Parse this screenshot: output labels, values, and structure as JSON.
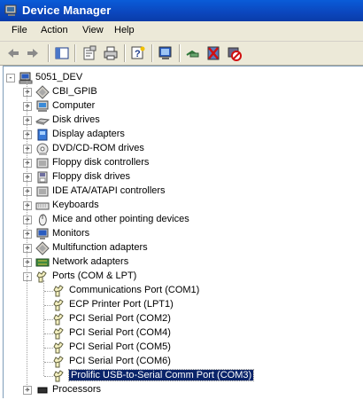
{
  "window": {
    "title": "Device Manager"
  },
  "menu": [
    "File",
    "Action",
    "View",
    "Help"
  ],
  "toolbar": {
    "buttons": [
      "back-icon",
      "forward-icon",
      "show-hide-tree-icon",
      "properties-icon",
      "print-icon",
      "help-icon",
      "scan-hardware-icon",
      "update-driver-icon",
      "uninstall-icon",
      "disable-icon"
    ]
  },
  "tree": {
    "root": "5051_DEV",
    "items": [
      {
        "label": "CBI_GPIB",
        "icon": "cbi-gpib-icon"
      },
      {
        "label": "Computer",
        "icon": "computer-icon"
      },
      {
        "label": "Disk drives",
        "icon": "disk-drive-icon"
      },
      {
        "label": "Display adapters",
        "icon": "display-adapter-icon"
      },
      {
        "label": "DVD/CD-ROM drives",
        "icon": "cdrom-icon"
      },
      {
        "label": "Floppy disk controllers",
        "icon": "floppy-controller-icon"
      },
      {
        "label": "Floppy disk drives",
        "icon": "floppy-drive-icon"
      },
      {
        "label": "IDE ATA/ATAPI controllers",
        "icon": "ide-controller-icon"
      },
      {
        "label": "Keyboards",
        "icon": "keyboard-icon"
      },
      {
        "label": "Mice and other pointing devices",
        "icon": "mouse-icon"
      },
      {
        "label": "Monitors",
        "icon": "monitor-icon"
      },
      {
        "label": "Multifunction adapters",
        "icon": "multifunction-icon"
      },
      {
        "label": "Network adapters",
        "icon": "network-adapter-icon"
      }
    ],
    "ports": {
      "label": "Ports (COM & LPT)",
      "children": [
        "Communications Port (COM1)",
        "ECP Printer Port (LPT1)",
        "PCI Serial Port (COM2)",
        "PCI Serial Port (COM4)",
        "PCI Serial Port (COM5)",
        "PCI Serial Port (COM6)",
        "Prolific USB-to-Serial Comm Port (COM3)"
      ],
      "selected": "Prolific USB-to-Serial Comm Port (COM3)"
    },
    "after": [
      {
        "label": "Processors",
        "icon": "processor-icon"
      }
    ]
  },
  "colors": {
    "title_bar": "#0b46bd",
    "selection": "#0a246a",
    "chrome": "#ece9d8"
  }
}
